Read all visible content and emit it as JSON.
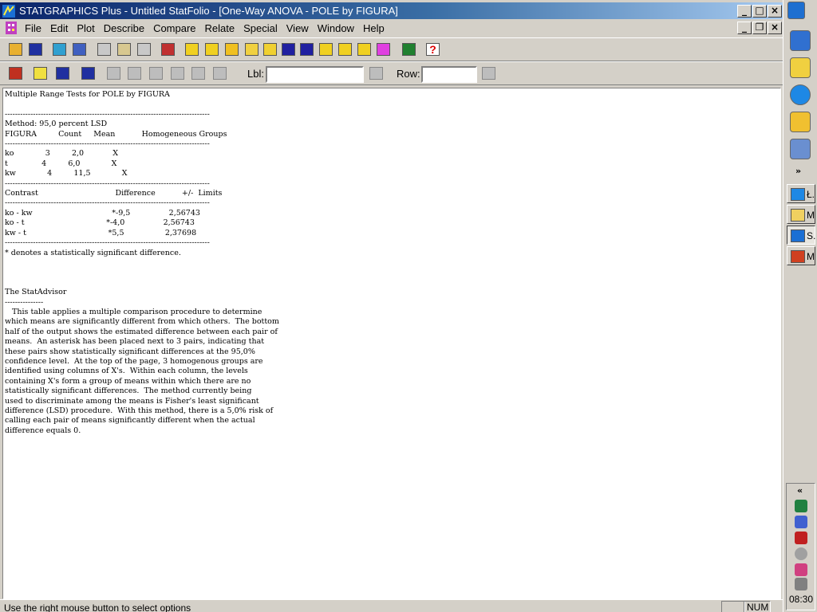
{
  "window": {
    "title": "STATGRAPHICS Plus - Untitled StatFolio - [One-Way ANOVA - POLE by FIGURA]",
    "caption_buttons": [
      "_",
      "□",
      "×"
    ],
    "doc_caption_buttons": [
      "_",
      "❐",
      "×"
    ]
  },
  "menubar": {
    "items": [
      "File",
      "Edit",
      "Plot",
      "Describe",
      "Compare",
      "Relate",
      "Special",
      "View",
      "Window",
      "Help"
    ]
  },
  "toolbar1": {
    "icons": [
      "open-icon",
      "save-icon",
      "spreadsheet-icon",
      "data-icon",
      "cut-icon",
      "copy-icon",
      "paste-icon",
      "print-icon",
      "analysis-1-icon",
      "analysis-2-icon",
      "bar-chart-icon",
      "scatter-icon",
      "grid-icon",
      "signal-icon",
      "peak-icon",
      "trend-icon",
      "globe-icon",
      "network-icon",
      "gallery-icon",
      "arrow-icon",
      "help-icon"
    ]
  },
  "toolbar2": {
    "icons": [
      "input-dialog-icon",
      "analysis-options-icon",
      "tables-icon",
      "graphs-icon",
      "pane-1-icon",
      "pane-2-icon",
      "pane-3-icon",
      "pane-4-icon",
      "pane-5-icon",
      "pane-6-icon"
    ],
    "lbl_label": "Lbl:",
    "lbl_value": "",
    "row_label": "Row:",
    "row_value": ""
  },
  "document": {
    "output": "Multiple Range Tests for POLE by FIGURA\n\n--------------------------------------------------------------------------------\nMethod: 95,0 percent LSD\nFIGURA         Count     Mean           Homogeneous Groups\n--------------------------------------------------------------------------------\nko             3         2,0            X\nt              4         6,0             X\nkw             4         11,5             X\n--------------------------------------------------------------------------------\nContrast                                Difference           +/-  Limits\n--------------------------------------------------------------------------------\nko - kw                                 *-9,5                2,56743\nko - t                                  *-4,0                2,56743\nkw - t                                  *5,5                 2,37698\n--------------------------------------------------------------------------------\n* denotes a statistically significant difference.\n\n\n\nThe StatAdvisor\n---------------\n   This table applies a multiple comparison procedure to determine\nwhich means are significantly different from which others.  The bottom\nhalf of the output shows the estimated difference between each pair of\nmeans.  An asterisk has been placed next to 3 pairs, indicating that\nthese pairs show statistically significant differences at the 95,0%\nconfidence level.  At the top of the page, 3 homogenous groups are\nidentified using columns of X's.  Within each column, the levels\ncontaining X's form a group of means within which there are no\nstatistically significant differences.  The method currently being\nused to discriminate among the means is Fisher's least significant\ndifference (LSD) procedure.  With this method, there is a 5,0% risk of\ncalling each pair of means significantly different when the actual\ndifference equals 0."
  },
  "statusbar": {
    "message": "Use the right mouse button to select options",
    "num": "NUM"
  },
  "taskbar": {
    "chevron_top": "»",
    "tasks": [
      {
        "label": "Ł.",
        "icon": "ie-icon"
      },
      {
        "label": "M",
        "icon": "folder-icon"
      },
      {
        "label": "S.",
        "icon": "statgraphics-icon"
      },
      {
        "label": "M",
        "icon": "powerpoint-icon"
      }
    ],
    "tray_chevron": "«",
    "clock": "08:30"
  }
}
